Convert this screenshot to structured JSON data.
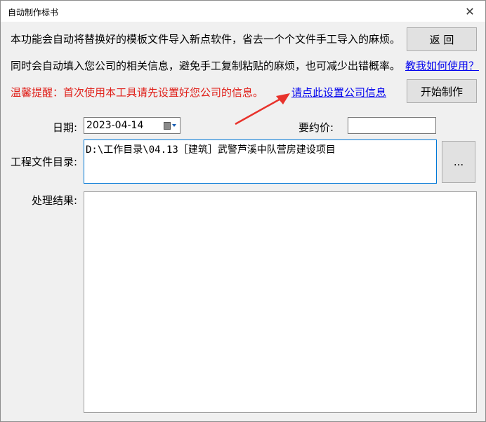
{
  "window": {
    "title": "自动制作标书",
    "close_glyph": "✕"
  },
  "intro": {
    "line1": "本功能会自动将替换好的模板文件导入新点软件，省去一个个文件手工导入的麻烦。",
    "line2": "同时会自动填入您公司的相关信息，避免手工复制粘贴的麻烦，也可减少出错概率。",
    "warning": "温馨提醒：首次使用本工具请先设置好您公司的信息。"
  },
  "links": {
    "help": "教我如何使用？",
    "settings": "请点此设置公司信息"
  },
  "buttons": {
    "back": "返 回",
    "start": "开始制作",
    "browse": "..."
  },
  "form": {
    "date_label": "日期:",
    "date_value": "2023-04-14",
    "price_label": "要约价:",
    "price_value": "",
    "dir_label": "工程文件目录:",
    "dir_value": "D:\\工作目录\\04.13［建筑］武警芦溪中队营房建设项目",
    "result_label": "处理结果:",
    "result_value": ""
  },
  "colors": {
    "warning": "#e0201a",
    "link": "#0000ee",
    "accent": "#0078d7",
    "arrow": "#e8322b"
  }
}
